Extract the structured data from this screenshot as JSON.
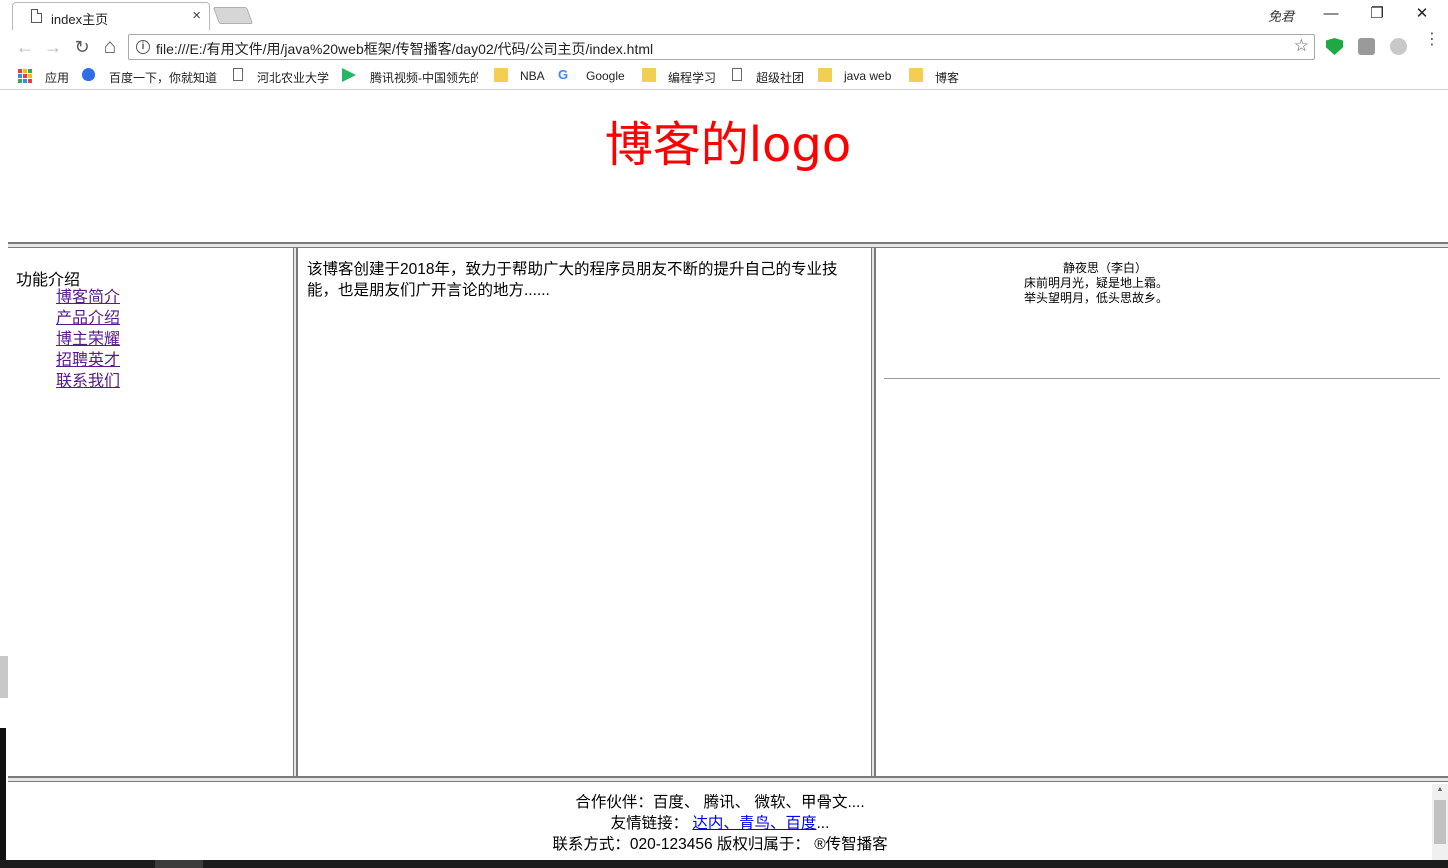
{
  "browser": {
    "tab_title": "index主页",
    "tab_close": "×",
    "profile_name": "免君",
    "window": {
      "minimize": "—",
      "restore": "❐",
      "close": "✕"
    },
    "nav": {
      "back": "←",
      "forward": "→",
      "reload": "↻",
      "home": "⌂"
    },
    "url": "file:///E:/有用文件/用/java%20web框架/传智播客/day02/代码/公司主页/index.html",
    "info_glyph": "i",
    "star": "☆",
    "menu": "⋮",
    "bookmarks": [
      {
        "label": "应用",
        "icon": "apps-grid-icon"
      },
      {
        "label": "百度一下，你就知道",
        "icon": "baidu-paw-icon"
      },
      {
        "label": "河北农业大学",
        "icon": "page-icon"
      },
      {
        "label": "腾讯视频-中国领先的",
        "icon": "tencent-video-icon"
      },
      {
        "label": "NBA",
        "icon": "folder-icon"
      },
      {
        "label": "Google",
        "icon": "google-icon"
      },
      {
        "label": "编程学习",
        "icon": "folder-icon"
      },
      {
        "label": "超级社团",
        "icon": "page-icon"
      },
      {
        "label": "java web",
        "icon": "folder-icon"
      },
      {
        "label": "博客",
        "icon": "folder-icon"
      }
    ],
    "google_glyph": "G"
  },
  "page": {
    "logo": "博客的logo",
    "logo_color": "#ff0000",
    "left": {
      "title": "功能介绍",
      "links": [
        "博客简介",
        "产品介绍",
        "博主荣耀",
        "招聘英才",
        "联系我们"
      ]
    },
    "middle": {
      "text": "该博客创建于2018年，致力于帮助广大的程序员朋友不断的提升自己的专业技能，也是朋友们广开言论的地方......"
    },
    "right": {
      "poem": [
        "静夜思（李白）",
        "床前明月光，疑是地上霜。",
        "举头望明月，低头思故乡。"
      ]
    },
    "footer": {
      "partners": "合作伙伴：百度、 腾讯、 微软、甲骨文....",
      "friends_prefix": "友情链接：",
      "friends_links": [
        "达内",
        "青鸟",
        "百度"
      ],
      "friends_sep": "、",
      "friends_suffix": "...",
      "contact": "联系方式：020-123456 版权归属于： ®传智播客"
    }
  }
}
